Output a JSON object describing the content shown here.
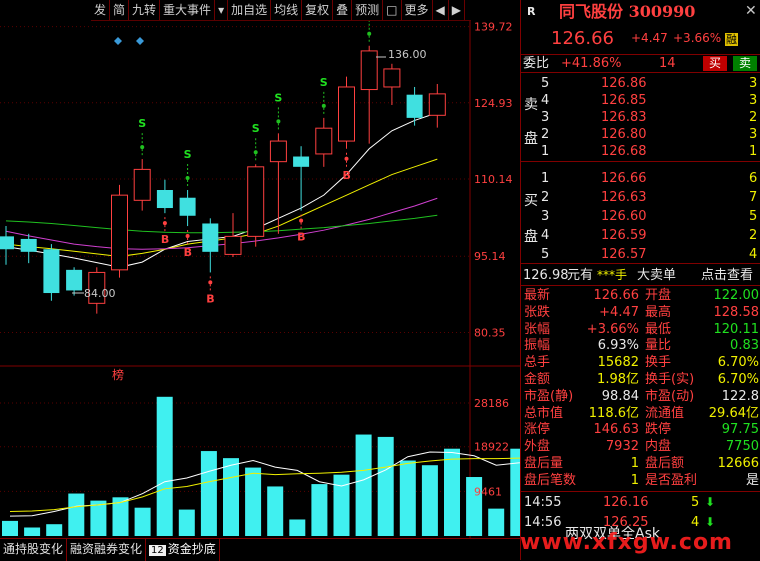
{
  "toolbar": {
    "items": [
      "发",
      "简",
      "九转",
      "重大事件",
      "▾",
      "加自选",
      "均线",
      "复权",
      "叠",
      "预测",
      "□",
      "更多",
      "◀",
      "▶"
    ]
  },
  "bottom_tabs": [
    {
      "label": "通持股变化"
    },
    {
      "label": "融资融券变化"
    },
    {
      "num": "12",
      "label": "资金抄底"
    }
  ],
  "chart_labels": {
    "high_marker": "136.00",
    "low_marker": "84.00",
    "bang": "榜"
  },
  "chart_data": [
    {
      "type": "candlestick",
      "y_ticks": [
        "139.72",
        "124.93",
        "110.14",
        "95.14",
        "80.35"
      ],
      "ylim": [
        75.0,
        141.0
      ],
      "candles": [
        {
          "o": 99.0,
          "c": 96.5,
          "h": 101.0,
          "l": 93.5
        },
        {
          "o": 98.5,
          "c": 96.0,
          "h": 99.5,
          "l": 93.8
        },
        {
          "o": 96.5,
          "c": 88.0,
          "h": 97.5,
          "l": 86.5
        },
        {
          "o": 92.5,
          "c": 88.5,
          "h": 93.0,
          "l": 87.5
        },
        {
          "o": 86.0,
          "c": 92.0,
          "h": 93.0,
          "l": 84.0
        },
        {
          "o": 92.5,
          "c": 107.0,
          "h": 109.0,
          "l": 91.0
        },
        {
          "o": 106.0,
          "c": 112.0,
          "h": 114.0,
          "l": 104.0
        },
        {
          "o": 108.0,
          "c": 104.5,
          "h": 110.0,
          "l": 103.5
        },
        {
          "o": 106.5,
          "c": 103.0,
          "h": 108.0,
          "l": 101.0
        },
        {
          "o": 101.5,
          "c": 96.0,
          "h": 102.5,
          "l": 92.0
        },
        {
          "o": 95.5,
          "c": 99.0,
          "h": 103.5,
          "l": 95.0
        },
        {
          "o": 99.0,
          "c": 112.5,
          "h": 113.0,
          "l": 97.0
        },
        {
          "o": 113.5,
          "c": 117.5,
          "h": 119.0,
          "l": 99.5
        },
        {
          "o": 114.5,
          "c": 112.5,
          "h": 116.5,
          "l": 104.0
        },
        {
          "o": 115.0,
          "c": 120.0,
          "h": 122.0,
          "l": 112.5
        },
        {
          "o": 117.5,
          "c": 128.0,
          "h": 130.0,
          "l": 116.0
        },
        {
          "o": 127.5,
          "c": 135.0,
          "h": 136.0,
          "l": 117.0
        },
        {
          "o": 128.0,
          "c": 131.5,
          "h": 132.5,
          "l": 124.5
        },
        {
          "o": 126.5,
          "c": 122.0,
          "h": 128.0,
          "l": 120.5
        },
        {
          "o": 122.5,
          "c": 126.66,
          "h": 128.58,
          "l": 120.11
        }
      ],
      "ma_series": [
        {
          "color": "#ffffff",
          "values": [
            97.0,
            96.3,
            95.6,
            94.8,
            93.9,
            93.0,
            94.0,
            96.5,
            98.0,
            98.5,
            99.0,
            100.5,
            102.5,
            104.5,
            107.0,
            111.0,
            116.0,
            119.5,
            121.5,
            123.0
          ]
        },
        {
          "color": "#f0f000",
          "values": [
            97.5,
            97.0,
            96.6,
            96.1,
            95.6,
            95.1,
            95.7,
            96.5,
            97.5,
            98.1,
            98.7,
            99.5,
            101.0,
            103.0,
            105.0,
            107.0,
            109.0,
            111.0,
            112.5,
            114.0
          ]
        },
        {
          "color": "#d040d0",
          "values": [
            100.0,
            99.1,
            98.3,
            97.5,
            97.0,
            96.6,
            96.5,
            96.6,
            96.8,
            97.2,
            97.6,
            98.1,
            98.7,
            99.4,
            100.2,
            101.2,
            102.3,
            103.6,
            104.9,
            106.4
          ]
        },
        {
          "color": "#20c020",
          "values": [
            102.0,
            101.8,
            101.5,
            101.1,
            100.7,
            100.3,
            100.0,
            99.8,
            99.7,
            99.7,
            99.8,
            99.9,
            100.1,
            100.4,
            100.7,
            101.1,
            101.5,
            102.0,
            102.5,
            103.1
          ]
        }
      ],
      "signals": [
        {
          "i": 6,
          "type": "S"
        },
        {
          "i": 7,
          "type": "B"
        },
        {
          "i": 8,
          "type": "S"
        },
        {
          "i": 8,
          "type": "B"
        },
        {
          "i": 9,
          "type": "B"
        },
        {
          "i": 11,
          "type": "S"
        },
        {
          "i": 12,
          "type": "S"
        },
        {
          "i": 13,
          "type": "B"
        },
        {
          "i": 14,
          "type": "S"
        },
        {
          "i": 15,
          "type": "B"
        },
        {
          "i": 16,
          "type": "S"
        }
      ]
    },
    {
      "type": "bar",
      "y_ticks": [
        "28186",
        "18922",
        "9461"
      ],
      "ylim": [
        0,
        32000
      ],
      "values": [
        3200,
        1800,
        2500,
        9000,
        7500,
        8200,
        6000,
        29500,
        5600,
        18000,
        16500,
        14500,
        10500,
        3500,
        11000,
        13000,
        21500,
        21000,
        16000,
        15000,
        18500,
        12500,
        5800,
        18500,
        17000,
        15600
      ],
      "ma_lines": [
        {
          "color": "#ffffff",
          "values": [
            4200,
            4300,
            5200,
            6300,
            6600,
            7100,
            9000,
            11500,
            12300,
            13700,
            15000,
            16000,
            14600,
            13900,
            11500,
            10600,
            11900,
            14000,
            16800,
            17800,
            17700,
            17000,
            15000,
            15500,
            15800,
            15400
          ]
        },
        {
          "color": "#f0f000",
          "values": [
            5200,
            5300,
            5600,
            6200,
            6600,
            7100,
            8300,
            10000,
            10500,
            11500,
            12400,
            13300,
            13000,
            13200,
            13300,
            13500,
            13900,
            14600,
            15400,
            15900,
            16300,
            16400,
            16400,
            16500,
            16700,
            16500
          ]
        }
      ]
    }
  ],
  "quote": {
    "r_label": "R",
    "name_code": "同飞股份 300990",
    "price": "126.66",
    "change": "+4.47",
    "change_pct": "+3.66%",
    "badge": "融",
    "weibi_label": "委比",
    "weibi_value": "+41.86%",
    "weibi_num": "14",
    "buy_btn": "买",
    "sell_btn": "卖",
    "sell_side_label": [
      "卖",
      "盘"
    ],
    "buy_side_label": [
      "买",
      "盘"
    ],
    "asks": [
      {
        "lv": "5",
        "price": "126.86",
        "vol": "3"
      },
      {
        "lv": "4",
        "price": "126.85",
        "vol": "3"
      },
      {
        "lv": "3",
        "price": "126.83",
        "vol": "2"
      },
      {
        "lv": "2",
        "price": "126.80",
        "vol": "3"
      },
      {
        "lv": "1",
        "price": "126.68",
        "vol": "1"
      }
    ],
    "bids": [
      {
        "lv": "1",
        "price": "126.66",
        "vol": "6"
      },
      {
        "lv": "2",
        "price": "126.63",
        "vol": "7"
      },
      {
        "lv": "3",
        "price": "126.60",
        "vol": "5"
      },
      {
        "lv": "4",
        "price": "126.59",
        "vol": "2"
      },
      {
        "lv": "5",
        "price": "126.57",
        "vol": "4"
      }
    ],
    "bigorder": {
      "price": "126.98",
      "yuan": "元有",
      "stars": "***手",
      "label": "大卖单",
      "link": "点击查看"
    },
    "stats": [
      {
        "k1": "最新",
        "v1": "126.66",
        "c1": "red",
        "k2": "开盘",
        "v2": "122.00",
        "c2": "green"
      },
      {
        "k1": "张跌",
        "v1": "+4.47",
        "c1": "red",
        "k2": "最高",
        "v2": "128.58",
        "c2": "red"
      },
      {
        "k1": "张幅",
        "v1": "+3.66%",
        "c1": "red",
        "k2": "最低",
        "v2": "120.11",
        "c2": "green"
      },
      {
        "k1": "振幅",
        "v1": "6.93%",
        "c1": "white",
        "k2": "量比",
        "v2": "0.83",
        "c2": "green"
      },
      {
        "k1": "总手",
        "v1": "15682",
        "c1": "yellow",
        "k2": "换手",
        "v2": "6.70%",
        "c2": "yellow"
      },
      {
        "k1": "金额",
        "v1": "1.98亿",
        "c1": "yellow",
        "k2": "换手(实)",
        "v2": "6.70%",
        "c2": "yellow"
      },
      {
        "k1": "市盈(静)",
        "v1": "98.84",
        "c1": "white",
        "k2": "市盈(动)",
        "v2": "122.8",
        "c2": "white"
      },
      {
        "k1": "总市值",
        "v1": "118.6亿",
        "c1": "yellow",
        "k2": "流通值",
        "v2": "29.64亿",
        "c2": "yellow"
      },
      {
        "k1": "涨停",
        "v1": "146.63",
        "c1": "red",
        "k2": "跌停",
        "v2": "97.75",
        "c2": "green"
      },
      {
        "k1": "外盘",
        "v1": "7932",
        "c1": "red",
        "k2": "内盘",
        "v2": "7750",
        "c2": "green"
      },
      {
        "k1": "盘后量",
        "v1": "1",
        "c1": "yellow",
        "k2": "盘后额",
        "v2": "12666",
        "c2": "yellow"
      },
      {
        "k1": "盘后笔数",
        "v1": "1",
        "c1": "yellow",
        "k2": "是否盈利",
        "v2": "是",
        "c2": "white"
      }
    ],
    "ticks": [
      {
        "time": "14:55",
        "price": "126.16",
        "vol": "5",
        "dir": "down"
      },
      {
        "time": "14:56",
        "price": "126.25",
        "vol": "4",
        "dir": "down"
      }
    ],
    "footer_text": "两双双单全Ask"
  },
  "watermark": "www.xfxgw.com"
}
